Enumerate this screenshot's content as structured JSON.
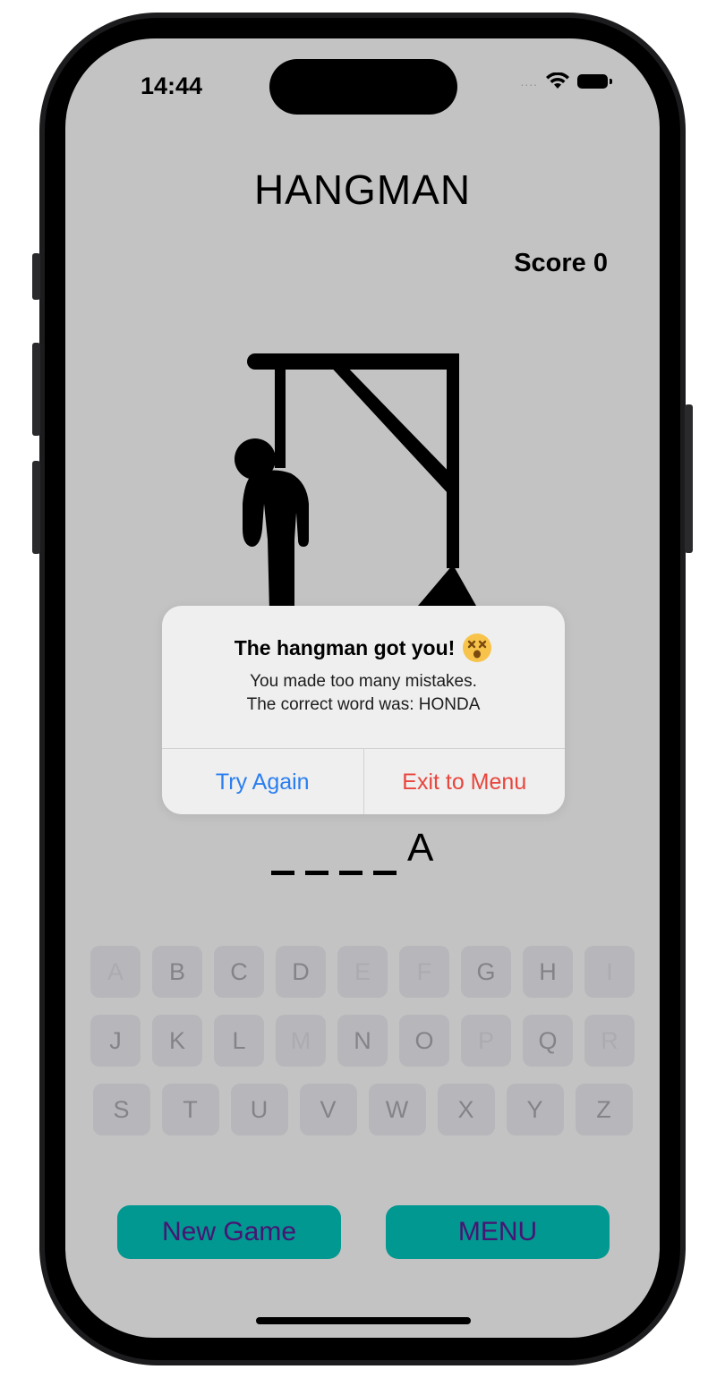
{
  "status_bar": {
    "time": "14:44",
    "signal": "....",
    "wifi_icon": "wifi-icon",
    "battery_icon": "battery-icon"
  },
  "header": {
    "title": "HANGMAN",
    "score_label": "Score 0"
  },
  "word": {
    "slots": [
      "",
      "",
      "",
      "",
      "A"
    ]
  },
  "keyboard": {
    "rows": [
      [
        "A",
        "B",
        "C",
        "D",
        "E",
        "F",
        "G",
        "H",
        "I"
      ],
      [
        "J",
        "K",
        "L",
        "M",
        "N",
        "O",
        "P",
        "Q",
        "R"
      ],
      [
        "S",
        "T",
        "U",
        "V",
        "W",
        "X",
        "Y",
        "Z"
      ]
    ],
    "used_letters": [
      "A",
      "E",
      "F",
      "I",
      "M",
      "P",
      "R"
    ]
  },
  "buttons": {
    "new_game": "New Game",
    "menu": "MENU"
  },
  "alert": {
    "title": "The hangman got you!",
    "emoji": "dizzy-face",
    "message_line1": "You made too many mistakes.",
    "message_line2": "The correct word was: HONDA",
    "try_again": "Try Again",
    "exit": "Exit to Menu"
  },
  "colors": {
    "background": "#cbcbcb",
    "accent_button": "#009f96",
    "button_text": "#4a1678",
    "alert_primary": "#2a7ef0",
    "alert_destructive": "#e8453c"
  }
}
